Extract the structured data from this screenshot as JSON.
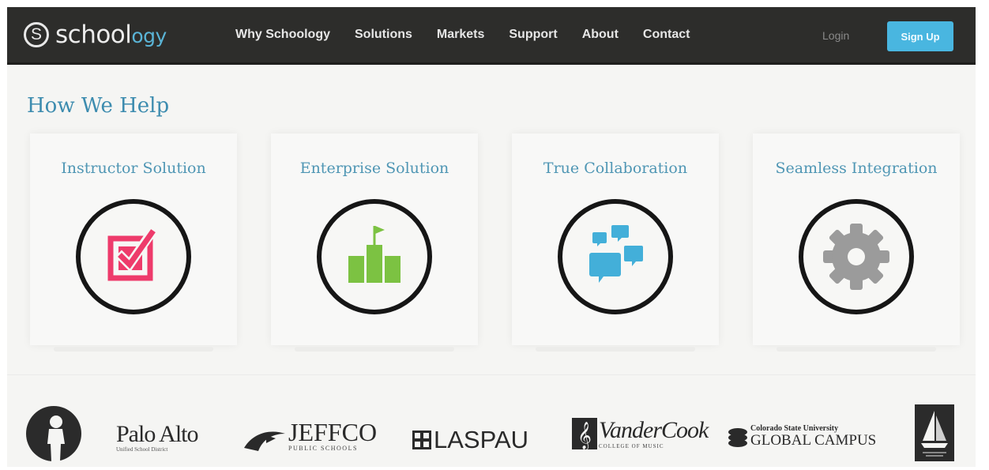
{
  "header": {
    "brand": {
      "prefix": "school",
      "accent": "ogy"
    },
    "nav": [
      "Why Schoology",
      "Solutions",
      "Markets",
      "Support",
      "About",
      "Contact"
    ],
    "login_label": "Login",
    "signup_label": "Sign Up"
  },
  "main": {
    "title": "How We Help",
    "solutions": [
      {
        "title": "Instructor Solution",
        "icon": "checkbox-icon",
        "color": "#ee3b6b"
      },
      {
        "title": "Enterprise Solution",
        "icon": "bar-chart-flag-icon",
        "color": "#7cc242"
      },
      {
        "title": "True Collaboration",
        "icon": "chat-bubbles-icon",
        "color": "#43afd9"
      },
      {
        "title": "Seamless Integration",
        "icon": "gear-icon",
        "color": "#9b9b9b"
      }
    ]
  },
  "partners": [
    {
      "name": "Palo Alto",
      "sub": "Unified School District"
    },
    {
      "name": "JEFFCO",
      "sub": "PUBLIC SCHOOLS"
    },
    {
      "name": "LASPAU"
    },
    {
      "name": "VanderCook",
      "sub": "COLLEGE OF MUSIC"
    },
    {
      "name": "Colorado State University",
      "sub": "GLOBAL CAMPUS"
    }
  ],
  "colors": {
    "nav_bg": "#2d2d2b",
    "accent": "#49b6e0",
    "heading": "#3d8caf"
  }
}
